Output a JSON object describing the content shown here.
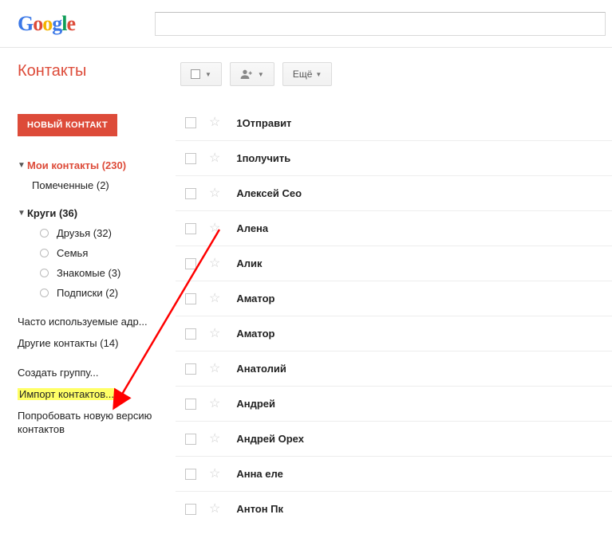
{
  "search": {
    "value": ""
  },
  "sidebar": {
    "title": "Контакты",
    "new_contact": "НОВЫЙ КОНТАКТ",
    "my_contacts": {
      "label": "Мои контакты",
      "count": "(230)"
    },
    "starred": {
      "label": "Помеченные",
      "count": "(2)"
    },
    "circles": {
      "label": "Круги",
      "count": "(36)"
    },
    "circle_items": [
      {
        "label": "Друзья",
        "count": "(32)"
      },
      {
        "label": "Семья",
        "count": ""
      },
      {
        "label": "Знакомые",
        "count": "(3)"
      },
      {
        "label": "Подписки",
        "count": "(2)"
      }
    ],
    "frequent": "Часто используемые адр...",
    "other": {
      "label": "Другие контакты",
      "count": "(14)"
    },
    "create_group": "Создать группу...",
    "import": "Импорт контактов...",
    "try_new": "Попробовать новую версию контактов"
  },
  "toolbar": {
    "more": "Ещё"
  },
  "contacts": [
    {
      "name": "1Отправит"
    },
    {
      "name": "1получить"
    },
    {
      "name": "Алексей Сео"
    },
    {
      "name": "Алена"
    },
    {
      "name": "Алик"
    },
    {
      "name": "Аматор"
    },
    {
      "name": "Аматор"
    },
    {
      "name": "Анатолий"
    },
    {
      "name": "Андрей"
    },
    {
      "name": "Андрей Орех"
    },
    {
      "name": "Анна еле"
    },
    {
      "name": "Антон Пк"
    }
  ]
}
